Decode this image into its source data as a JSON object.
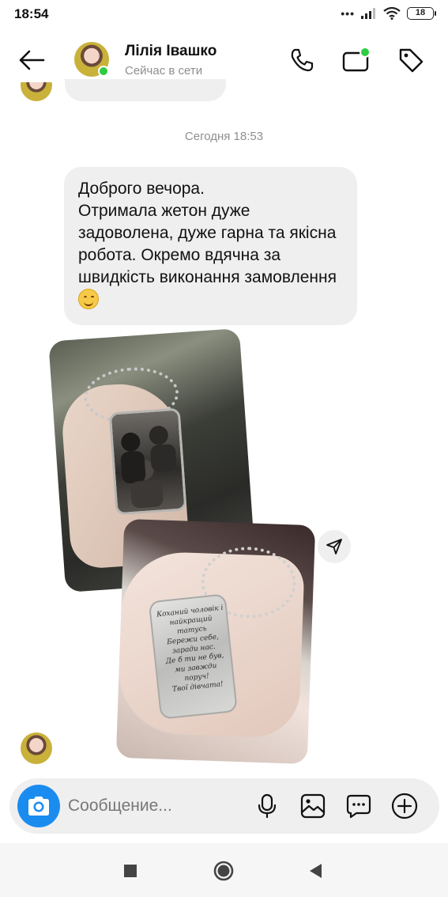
{
  "status_bar": {
    "time": "18:54",
    "battery": "18"
  },
  "header": {
    "back_icon": "arrow-left-icon",
    "contact_name": "Лілія Івашко",
    "contact_status": "Сейчас в сети",
    "call_icon": "phone-icon",
    "video_icon": "video-call-icon",
    "tag_icon": "tag-icon"
  },
  "conversation": {
    "timestamp": "Сегодня 18:53",
    "message_text": "Доброго вечора.\nОтримала жетон дуже задоволена, дуже гарна та якісна робота. Окремо вдячна за швидкість виконання замовлення ",
    "message_emoji": "smiling-face-emoji",
    "photo_2_engraving": "Коханий чоловік і\nнайкращий татусь\nБережи себе,\nзаради нас.\nДе б ти не був,\nми завжди поруч!\nТвої дівчата!"
  },
  "composer": {
    "placeholder": "Сообщение...",
    "camera_icon": "camera-icon",
    "mic_icon": "microphone-icon",
    "gallery_icon": "image-icon",
    "sticker_icon": "chat-bubble-icon",
    "plus_icon": "plus-circle-icon"
  },
  "colors": {
    "accent": "#1a8cf0",
    "online": "#2ecc40",
    "bubble": "#efefef",
    "muted_text": "#8e8e8e"
  }
}
